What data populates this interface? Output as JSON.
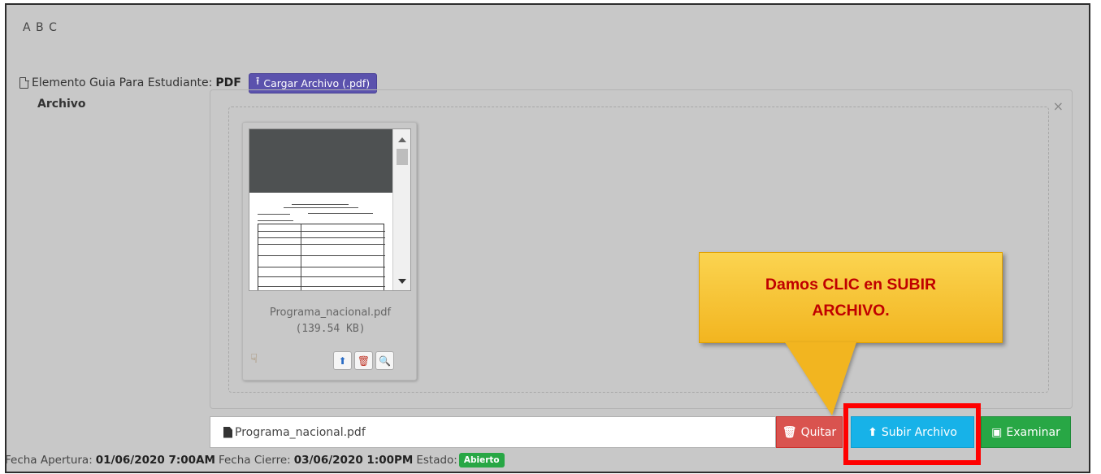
{
  "heading": "A B C",
  "guide": {
    "label": "Elemento Guia Para Estudiante:",
    "type": "PDF",
    "upload_button": "Cargar Archivo (.pdf)"
  },
  "archivo_label": "Archivo",
  "preview": {
    "close_symbol": "×",
    "file_name": "Programa_nacional.pdf",
    "file_size": "(139.54 KB)"
  },
  "callout": {
    "text": "Damos CLIC en SUBIR ARCHIVO.",
    "color": "#c00000"
  },
  "file_input": {
    "value": "Programa_nacional.pdf"
  },
  "buttons": {
    "quitar": "Quitar",
    "subir": "Subir Archivo",
    "examinar": "Examinar"
  },
  "footer": {
    "apertura_label": "Fecha Apertura:",
    "apertura_value": "01/06/2020 7:00AM",
    "cierre_label": "Fecha Cierre:",
    "cierre_value": "03/06/2020 1:00PM",
    "estado_label": "Estado:",
    "estado_value": "Abierto"
  },
  "colors": {
    "panel_bg": "#c8c8c8",
    "upload_btn": "#5b52ad",
    "quitar_btn": "#d9534f",
    "subir_btn": "#17b2e8",
    "examinar_btn": "#28a745",
    "highlight_border": "#ff0000"
  }
}
